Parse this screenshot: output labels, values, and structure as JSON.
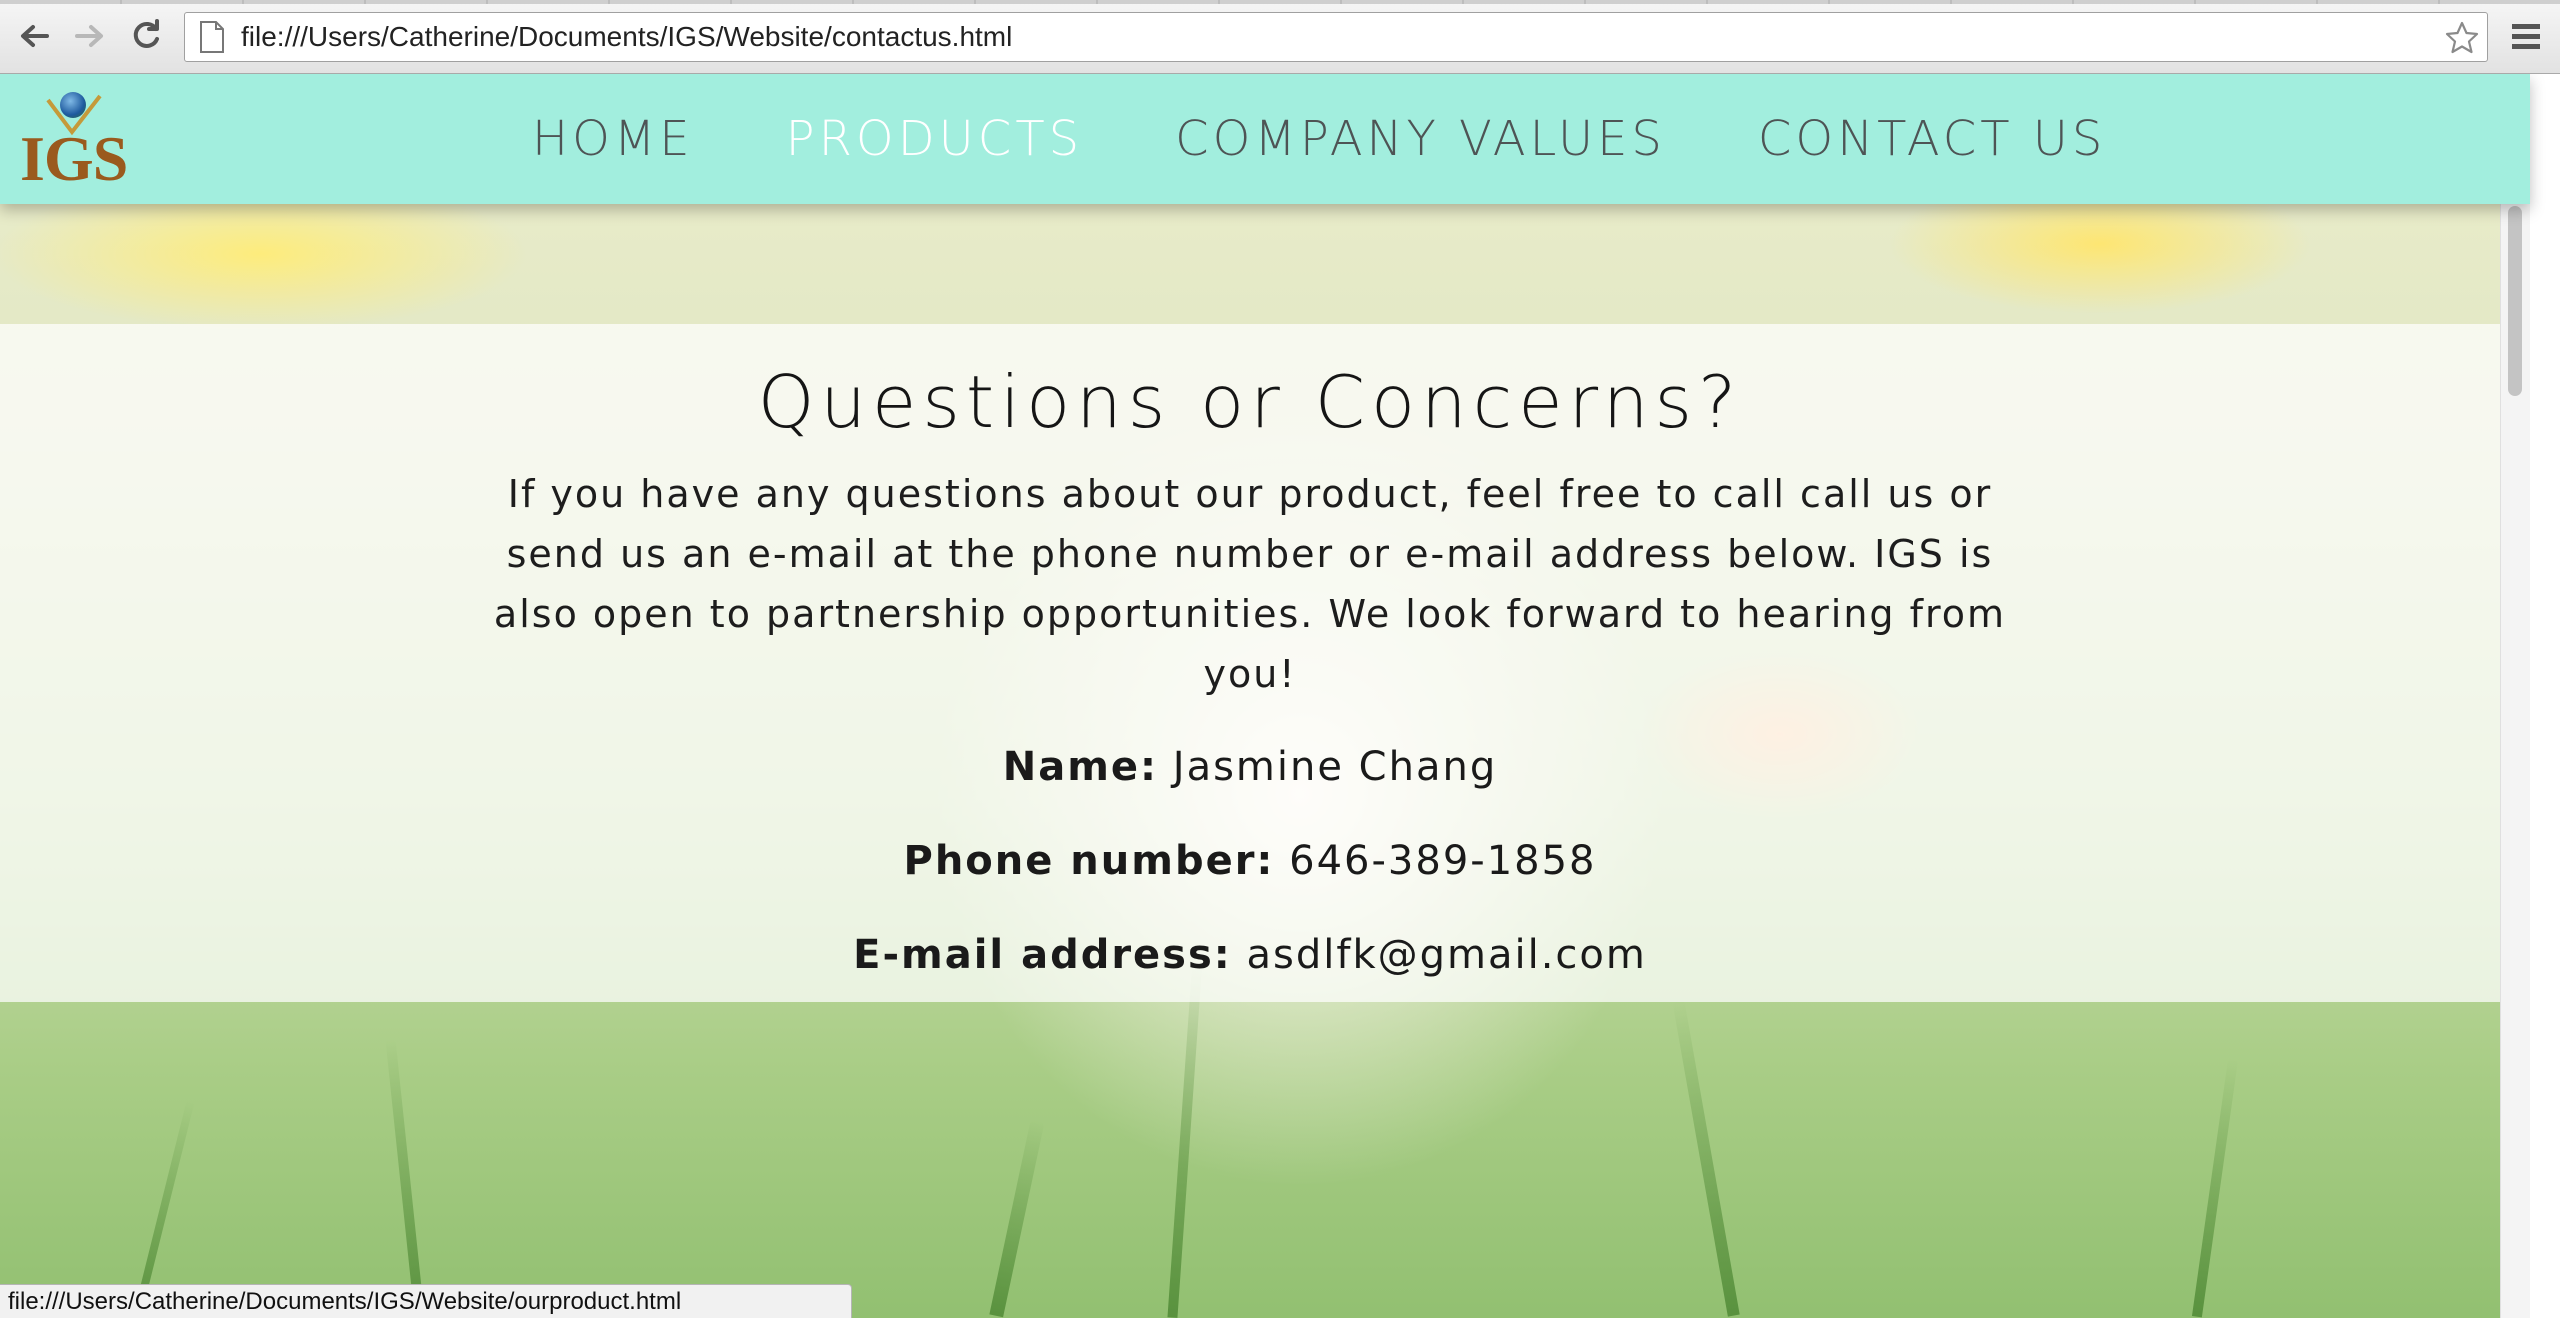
{
  "browser": {
    "url": "file:///Users/Catherine/Documents/IGS/Website/contactus.html",
    "status_url": "file:///Users/Catherine/Documents/IGS/Website/ourproduct.html"
  },
  "site": {
    "logo_text": "IGS",
    "nav": [
      {
        "label": "HOME",
        "hovered": false
      },
      {
        "label": "PRODUCTS",
        "hovered": true
      },
      {
        "label": "COMPANY VALUES",
        "hovered": false
      },
      {
        "label": "CONTACT US",
        "hovered": false
      }
    ],
    "nav_color": "#a2eede",
    "brand_color": "#9a5a1e"
  },
  "contact": {
    "title": "Questions or Concerns?",
    "intro": "If you have any questions about our product, feel free to call call us or send us an e-mail at the phone number or e-mail address below. IGS is also open to partnership opportunities. We look forward to hearing from you!",
    "name_label": "Name:",
    "name_value": "Jasmine Chang",
    "phone_label": "Phone number:",
    "phone_value": "646-389-1858",
    "email_label": "E-mail address:",
    "email_value": "asdlfk@gmail.com"
  },
  "icons": {
    "back": "back-arrow-icon",
    "forward": "forward-arrow-icon",
    "reload": "reload-icon",
    "page": "page-icon",
    "bookmark": "star-icon",
    "menu": "hamburger-menu-icon"
  }
}
